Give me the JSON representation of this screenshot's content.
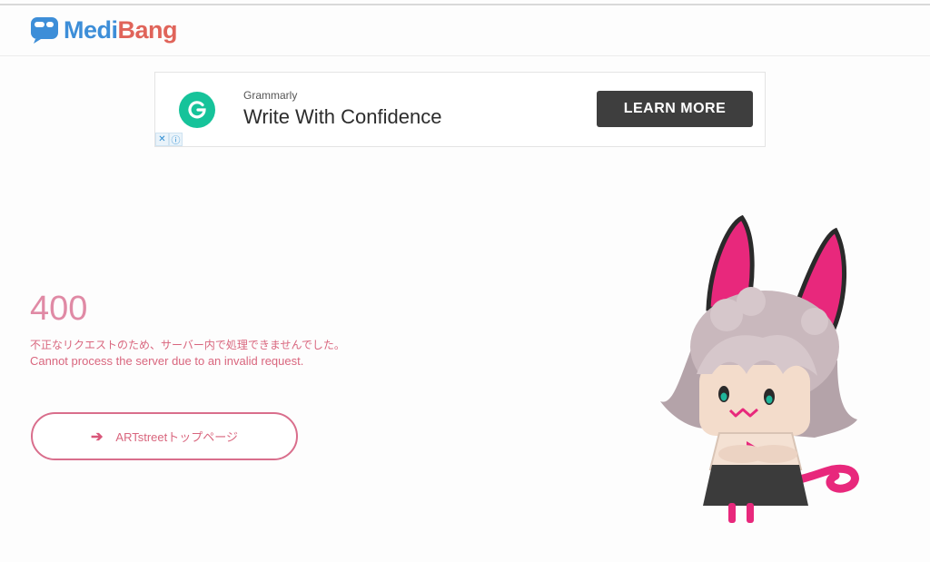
{
  "header": {
    "logo_medi": "Medi",
    "logo_bang": "Bang"
  },
  "ad": {
    "brand": "Grammarly",
    "headline": "Write With Confidence",
    "cta_label": "LEARN MORE",
    "close_glyph": "✕",
    "info_glyph": "ⓘ",
    "logo_letter": "G"
  },
  "error": {
    "code": "400",
    "message_ja": "不正なリクエストのため、サーバー内で処理できませんでした。",
    "message_en": "Cannot process the server due to an invalid request."
  },
  "home_button": {
    "arrow": "➔",
    "label": "ARTstreetトップページ"
  },
  "colors": {
    "brand_blue": "#3d8ed8",
    "brand_red": "#e0645a",
    "accent_pink": "#d9667e",
    "ad_green": "#16c39a"
  }
}
